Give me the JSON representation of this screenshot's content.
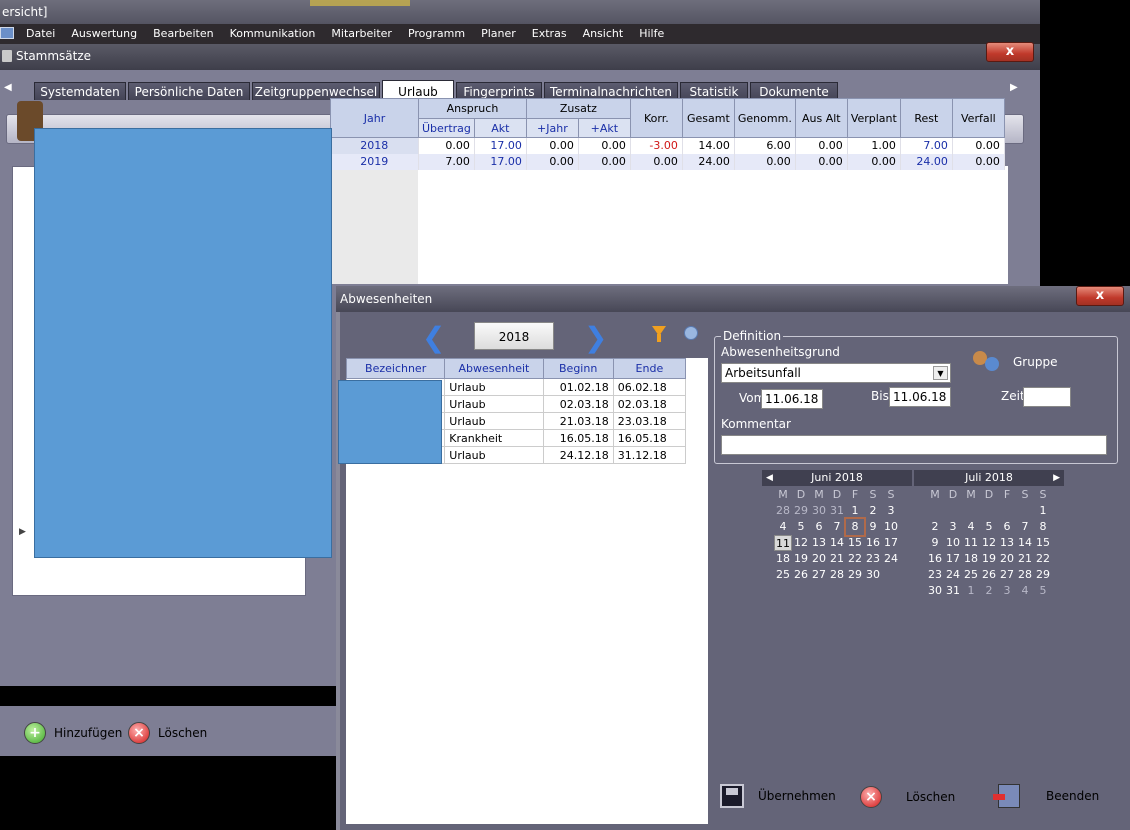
{
  "main_window": {
    "title": "ersicht]",
    "menu": [
      "Datei",
      "Auswertung",
      "Bearbeiten",
      "Kommunikation",
      "Mitarbeiter",
      "Programm",
      "Planer",
      "Extras",
      "Ansicht",
      "Hilfe"
    ]
  },
  "stammsaetze": {
    "title": "Stammsätze",
    "close_label": "x",
    "tabs": [
      "Systemdaten",
      "Persönliche Daten",
      "Zeitgruppenwechsel",
      "Urlaub",
      "Fingerprints",
      "Terminalnachrichten",
      "Statistik",
      "Dokumente"
    ],
    "active_tab": "Urlaub",
    "urlaub_table": {
      "headers": {
        "jahr": "Jahr",
        "anspruch": "Anspruch",
        "uebertrag": "Übertrag",
        "akt": "Akt",
        "zusatz": "Zusatz",
        "plus_jahr": "+Jahr",
        "plus_akt": "+Akt",
        "korr": "Korr.",
        "gesamt": "Gesamt",
        "genomm": "Genomm.",
        "aus_alt": "Aus Alt",
        "verplant": "Verplant",
        "rest": "Rest",
        "verfall": "Verfall"
      },
      "rows": [
        {
          "jahr": "2018",
          "uebertrag": "0.00",
          "akt": "17.00",
          "plus_jahr": "0.00",
          "plus_akt": "0.00",
          "korr": "-3.00",
          "gesamt": "14.00",
          "genomm": "6.00",
          "aus_alt": "0.00",
          "verplant": "1.00",
          "rest": "7.00",
          "verfall": "0.00"
        },
        {
          "jahr": "2019",
          "uebertrag": "7.00",
          "akt": "17.00",
          "plus_jahr": "0.00",
          "plus_akt": "0.00",
          "korr": "0.00",
          "gesamt": "24.00",
          "genomm": "0.00",
          "aus_alt": "0.00",
          "verplant": "0.00",
          "rest": "24.00",
          "verfall": "0.00"
        }
      ]
    },
    "footer": {
      "add_label": "Hinzufügen",
      "delete_label": "Löschen"
    }
  },
  "abwesenheiten": {
    "title": "Abwesenheiten",
    "close_label": "x",
    "year": "2018",
    "table": {
      "headers": [
        "Bezeichner",
        "Abwesenheit",
        "Beginn",
        "Ende"
      ],
      "rows": [
        {
          "abwesenheit": "Urlaub",
          "beginn": "01.02.18",
          "ende": "06.02.18"
        },
        {
          "abwesenheit": "Urlaub",
          "beginn": "02.03.18",
          "ende": "02.03.18"
        },
        {
          "abwesenheit": "Urlaub",
          "beginn": "21.03.18",
          "ende": "23.03.18"
        },
        {
          "abwesenheit": "Krankheit",
          "beginn": "16.05.18",
          "ende": "16.05.18"
        },
        {
          "abwesenheit": "Urlaub",
          "beginn": "24.12.18",
          "ende": "31.12.18"
        }
      ]
    },
    "definition": {
      "legend": "Definition",
      "grund_label": "Abwesenheitsgrund",
      "grund_value": "Arbeitsunfall",
      "gruppe_label": "Gruppe",
      "vom_label": "Vom",
      "vom_value": "11.06.18",
      "bis_label": "Bis",
      "bis_value": "11.06.18",
      "zeit_label": "Zeit",
      "zeit_value": "",
      "kommentar_label": "Kommentar",
      "kommentar_value": ""
    },
    "calendar": {
      "weekdays": [
        "M",
        "D",
        "M",
        "D",
        "F",
        "S",
        "S"
      ],
      "months": [
        {
          "title": "Juni 2018",
          "days": [
            "28",
            "29",
            "30",
            "31",
            "1",
            "2",
            "3",
            "4",
            "5",
            "6",
            "7",
            "8",
            "9",
            "10",
            "11",
            "12",
            "13",
            "14",
            "15",
            "16",
            "17",
            "18",
            "19",
            "20",
            "21",
            "22",
            "23",
            "24",
            "25",
            "26",
            "27",
            "28",
            "29",
            "30"
          ],
          "other_month_count_leading": 4,
          "today": "11",
          "circled": "8"
        },
        {
          "title": "Juli 2018",
          "days": [
            "",
            "",
            "",
            "",
            "",
            "",
            "1",
            "2",
            "3",
            "4",
            "5",
            "6",
            "7",
            "8",
            "9",
            "10",
            "11",
            "12",
            "13",
            "14",
            "15",
            "16",
            "17",
            "18",
            "19",
            "20",
            "21",
            "22",
            "23",
            "24",
            "25",
            "26",
            "27",
            "28",
            "29",
            "30",
            "31",
            "1",
            "2",
            "3",
            "4",
            "5"
          ],
          "trailing_other_count": 5
        }
      ]
    },
    "buttons": {
      "save_label": "Übernehmen",
      "delete_label": "Löschen",
      "exit_label": "Beenden"
    }
  }
}
